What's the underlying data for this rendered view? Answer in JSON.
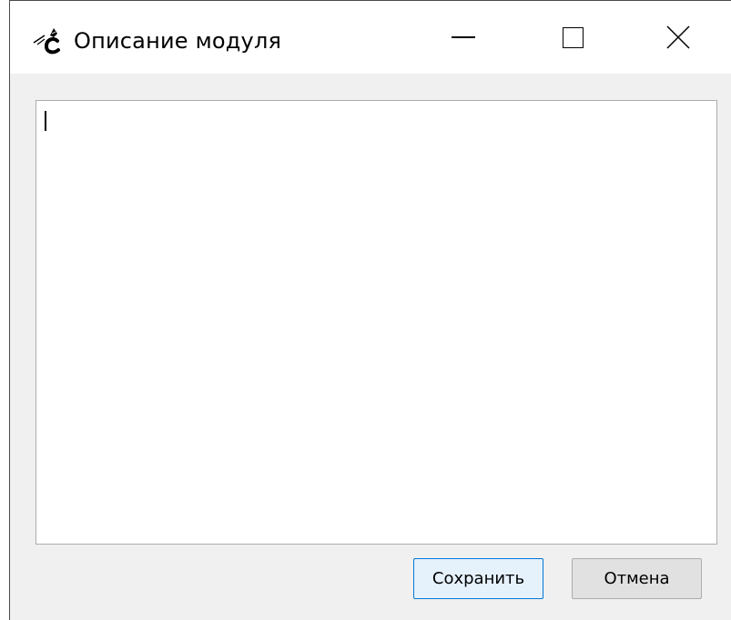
{
  "window": {
    "title": "Описание модуля",
    "app_icon": "app-logo-icon",
    "controls": {
      "minimize_icon": "minimize-icon",
      "maximize_icon": "maximize-icon",
      "close_icon": "close-icon"
    }
  },
  "editor": {
    "value": ""
  },
  "buttons": {
    "save_label": "Сохранить",
    "cancel_label": "Отмена"
  },
  "colors": {
    "accent": "#0078d7",
    "window_bg": "#f0f0f0",
    "titlebar_bg": "#ffffff"
  }
}
